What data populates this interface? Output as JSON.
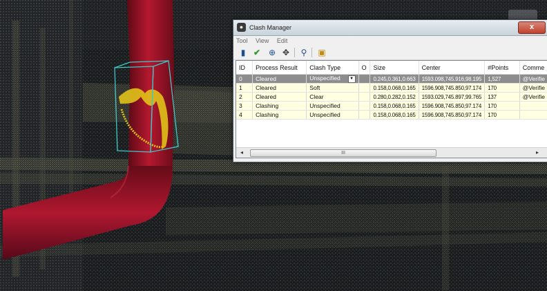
{
  "window": {
    "title": "Clash Manager",
    "icon": "app-logo-icon",
    "close_glyph": "x"
  },
  "menu": [
    "Tool",
    "View",
    "Edit"
  ],
  "toolbar_icons": [
    "binoculars-add-icon",
    "checkmark-icon",
    "zoom-clash-icon",
    "move-icon",
    "find-icon",
    "report-icon"
  ],
  "table": {
    "columns": [
      "ID",
      "Process Result",
      "Clash Type",
      "O",
      "Size",
      "Center",
      "#Points",
      "Comme"
    ],
    "rows": [
      {
        "id": "0",
        "result": "Cleared",
        "type": "Unspecified",
        "o": "",
        "size": "0.245,0.361,0.663",
        "center": "1593.098,745.916,98.195",
        "points": "1,527",
        "comment": "@Verifie",
        "selected": true
      },
      {
        "id": "1",
        "result": "Cleared",
        "type": "Soft",
        "o": "",
        "size": "0.158,0.068,0.165",
        "center": "1596.908,745.850,97.174",
        "points": "170",
        "comment": "@Verifie",
        "selected": false
      },
      {
        "id": "2",
        "result": "Cleared",
        "type": "Clear",
        "o": "",
        "size": "0.280,0.282,0.152",
        "center": "1593.029,745.897,99.765",
        "points": "137",
        "comment": "@Verifie",
        "selected": false
      },
      {
        "id": "3",
        "result": "Clashing",
        "type": "Unspecified",
        "o": "",
        "size": "0.158,0.068,0.165",
        "center": "1596.908,745.850,97.174",
        "points": "170",
        "comment": "",
        "selected": false
      },
      {
        "id": "4",
        "result": "Clashing",
        "type": "Unspecified",
        "o": "",
        "size": "0.158,0.068,0.165",
        "center": "1596.908,745.850,97.174",
        "points": "170",
        "comment": "",
        "selected": false
      }
    ]
  },
  "scrollbar": {
    "thumb_grip": "III"
  },
  "colors": {
    "pipe": "#a1132a",
    "clash_box": "#3ec9c9",
    "clash_points": "#e0c21a",
    "row_bg": "#ffffe1",
    "row_selected": "#8d8d8d"
  }
}
